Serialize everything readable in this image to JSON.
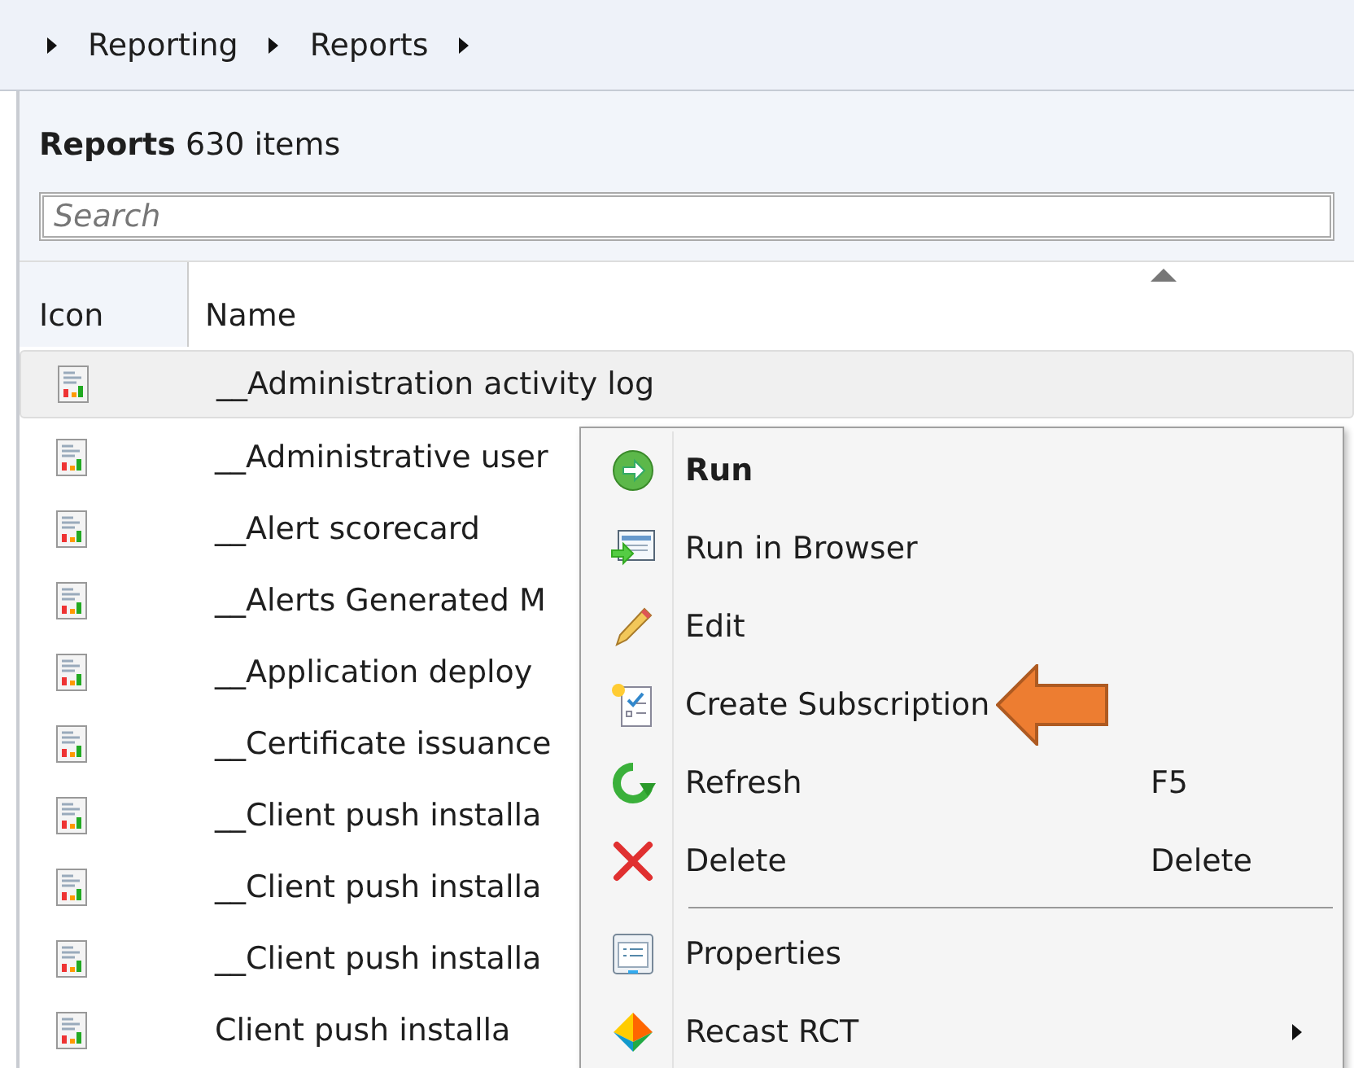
{
  "breadcrumb": [
    "Reporting",
    "Reports"
  ],
  "panel": {
    "title": "Reports",
    "count": "630 items"
  },
  "search": {
    "placeholder": "Search"
  },
  "table": {
    "columns": [
      "Icon",
      "Name"
    ],
    "rows": [
      {
        "name": "__Administration activity log",
        "selected": true
      },
      {
        "name": "__Administrative user",
        "selected": false
      },
      {
        "name": "__Alert scorecard",
        "selected": false
      },
      {
        "name": "__Alerts Generated M",
        "selected": false
      },
      {
        "name": "__Application deploy",
        "selected": false
      },
      {
        "name": "__Certificate issuance",
        "selected": false
      },
      {
        "name": "__Client push installa",
        "selected": false
      },
      {
        "name": "__Client push installa",
        "selected": false
      },
      {
        "name": "__Client push installa",
        "selected": false
      },
      {
        "name": "Client push installa",
        "selected": false
      }
    ]
  },
  "context_menu": [
    {
      "kind": "item",
      "label": "Run",
      "default": true
    },
    {
      "kind": "item",
      "label": "Run in Browser",
      "default": false
    },
    {
      "kind": "item",
      "label": "Edit",
      "default": false
    },
    {
      "kind": "item",
      "label": "Create Subscription",
      "default": false,
      "callout": true
    },
    {
      "kind": "item",
      "label": "Refresh",
      "shortcut": "F5",
      "default": false
    },
    {
      "kind": "item",
      "label": "Delete",
      "shortcut": "Delete",
      "default": false
    },
    {
      "kind": "separator"
    },
    {
      "kind": "item",
      "label": "Properties",
      "default": false
    },
    {
      "kind": "item",
      "label": "Recast RCT",
      "default": false,
      "submenu": true
    }
  ]
}
